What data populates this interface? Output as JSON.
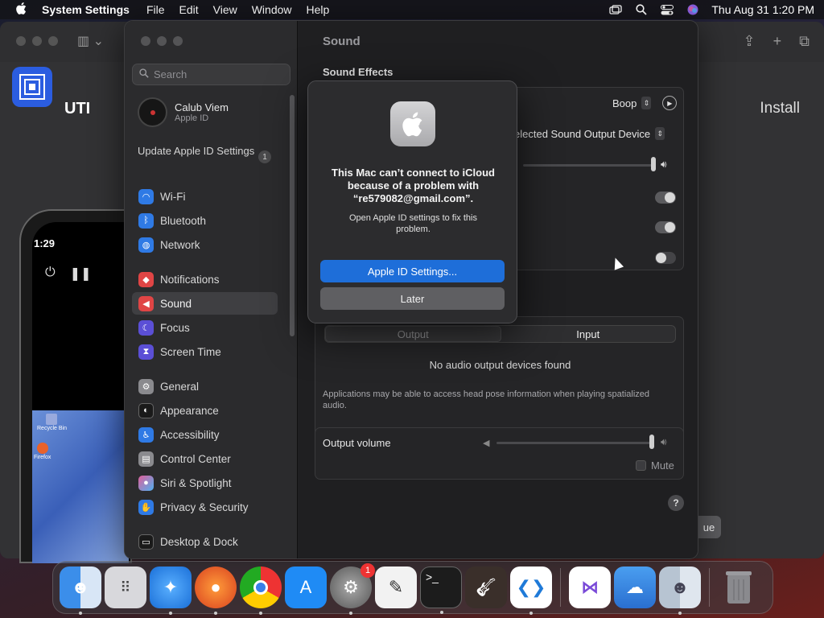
{
  "menubar": {
    "app_name": "System Settings",
    "items": [
      "File",
      "Edit",
      "View",
      "Window",
      "Help"
    ],
    "datetime": "Thu Aug 31  1:20 PM"
  },
  "utm": {
    "title": "UTI",
    "install_label": "Install",
    "continue_label": "ue",
    "phone_time": "1:29",
    "desktop_icons": [
      "Recycle Bin",
      "Firefox"
    ]
  },
  "settings": {
    "search_placeholder": "Search",
    "account": {
      "name": "Calub Viem",
      "sub": "Apple ID"
    },
    "update": {
      "label": "Update Apple ID Settings",
      "badge": "1"
    },
    "sidebar": [
      {
        "label": "Wi-Fi",
        "icon": "wifi-icon",
        "color": "#2f7ae5"
      },
      {
        "label": "Bluetooth",
        "icon": "bluetooth-icon",
        "color": "#2f7ae5"
      },
      {
        "label": "Network",
        "icon": "globe-icon",
        "color": "#2f7ae5"
      },
      {
        "label": "Notifications",
        "icon": "bell-icon",
        "color": "#e04545"
      },
      {
        "label": "Sound",
        "icon": "speaker-icon",
        "color": "#e04545"
      },
      {
        "label": "Focus",
        "icon": "moon-icon",
        "color": "#5b4fd6"
      },
      {
        "label": "Screen Time",
        "icon": "hourglass-icon",
        "color": "#5b4fd6"
      },
      {
        "label": "General",
        "icon": "gear-icon",
        "color": "#8a8a8e"
      },
      {
        "label": "Appearance",
        "icon": "appearance-icon",
        "color": "#2a2a2c"
      },
      {
        "label": "Accessibility",
        "icon": "accessibility-icon",
        "color": "#2f7ae5"
      },
      {
        "label": "Control Center",
        "icon": "control-center-icon",
        "color": "#8a8a8e"
      },
      {
        "label": "Siri & Spotlight",
        "icon": "siri-icon",
        "color": "#b146c2"
      },
      {
        "label": "Privacy & Security",
        "icon": "hand-icon",
        "color": "#2f7ae5"
      },
      {
        "label": "Desktop & Dock",
        "icon": "dock-icon",
        "color": "#2a2a2c"
      }
    ],
    "pane": {
      "title": "Sound",
      "section": "Sound Effects",
      "alert_sound": "Boop",
      "play_through": "elected Sound Output Device",
      "segments": {
        "output": "Output",
        "input": "Input"
      },
      "no_devices": "No audio output devices found",
      "head_pose_note": "Applications may be able to access head pose information when playing spatialized audio.",
      "output_volume_label": "Output volume",
      "mute_label": "Mute",
      "help_label": "?"
    }
  },
  "alert": {
    "title": "This Mac can’t connect to iCloud because of a problem with “re579082@gmail.com”.",
    "message": "Open Apple ID settings to fix this problem.",
    "primary": "Apple ID Settings...",
    "secondary": "Later"
  },
  "dock": {
    "apps": [
      {
        "name": "finder-icon",
        "color": "#3b8eea"
      },
      {
        "name": "launchpad-icon",
        "color": "#d8d8dc"
      },
      {
        "name": "safari-icon",
        "color": "#2f8ff0"
      },
      {
        "name": "firefox-icon",
        "color": "#e8622b"
      },
      {
        "name": "chrome-icon",
        "color": "#f2f2f2"
      },
      {
        "name": "app-store-icon",
        "color": "#1f8bf5"
      },
      {
        "name": "system-settings-icon",
        "color": "#7a7a7e",
        "badge": "1"
      },
      {
        "name": "textedit-icon",
        "color": "#f2f2f2"
      },
      {
        "name": "terminal-icon",
        "color": "#1c1c1c"
      },
      {
        "name": "garageband-icon",
        "color": "#3a2f2a"
      },
      {
        "name": "vscode-icon",
        "color": "#ffffff"
      },
      {
        "name": "visual-studio-icon",
        "color": "#ffffff"
      },
      {
        "name": "weather-icon",
        "color": "#3c8ee6"
      },
      {
        "name": "finder-icon-2",
        "color": "#b7c4d2"
      },
      {
        "name": "trash-icon",
        "color": "#7a7a7e"
      }
    ]
  }
}
